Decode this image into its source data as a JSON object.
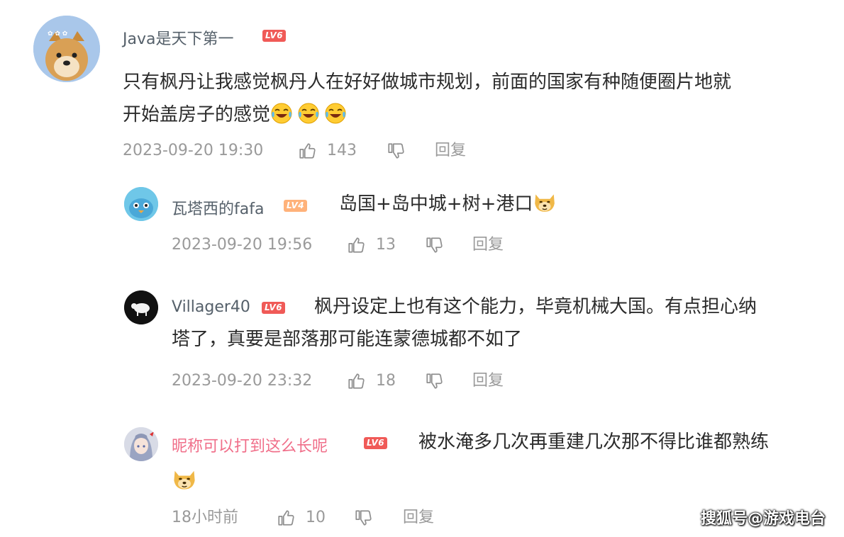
{
  "comments": [
    {
      "username": "Java是天下第一",
      "level": "LV6",
      "text": "只有枫丹让我感觉枫丹人在好好做城市规划，前面的国家有种随便圈片地就开始盖房子的感觉",
      "text_line1": "只有枫丹让我感觉枫丹人在好好做城市规划，前面的国家有种随便圈片地就",
      "text_line2": "开始盖房子的感觉",
      "emojis": [
        "crying-laughing-emoji",
        "crying-laughing-emoji",
        "crying-laughing-emoji"
      ],
      "timestamp": "2023-09-20 19:30",
      "likes": "143",
      "reply_label": "回复"
    }
  ],
  "replies": [
    {
      "username": "瓦塔西的fafa",
      "level": "LV4",
      "text": "岛国+岛中城+树+港口",
      "emojis": [
        "doge-emoji"
      ],
      "timestamp": "2023-09-20 19:56",
      "likes": "13",
      "reply_label": "回复"
    },
    {
      "username": "Villager40",
      "level": "LV6",
      "text_line1": "枫丹设定上也有这个能力，毕竟机械大国。有点担心纳",
      "text_line2": "塔了，真要是部落那可能连蒙德城都不如了",
      "timestamp": "2023-09-20 23:32",
      "likes": "18",
      "reply_label": "回复"
    },
    {
      "username": "昵称可以打到这么长呢",
      "level": "LV6",
      "text": "被水淹多几次再重建几次那不得比谁都熟练",
      "emojis": [
        "doge-emoji"
      ],
      "timestamp": "18小时前",
      "likes": "10",
      "reply_label": "回复"
    }
  ],
  "watermark": "搜狐号@游戏电台",
  "colors": {
    "level_red": "#f05a57",
    "level_orange": "#ffb27a",
    "pink_name": "#f06e89",
    "meta_gray": "#9a9a9a"
  }
}
